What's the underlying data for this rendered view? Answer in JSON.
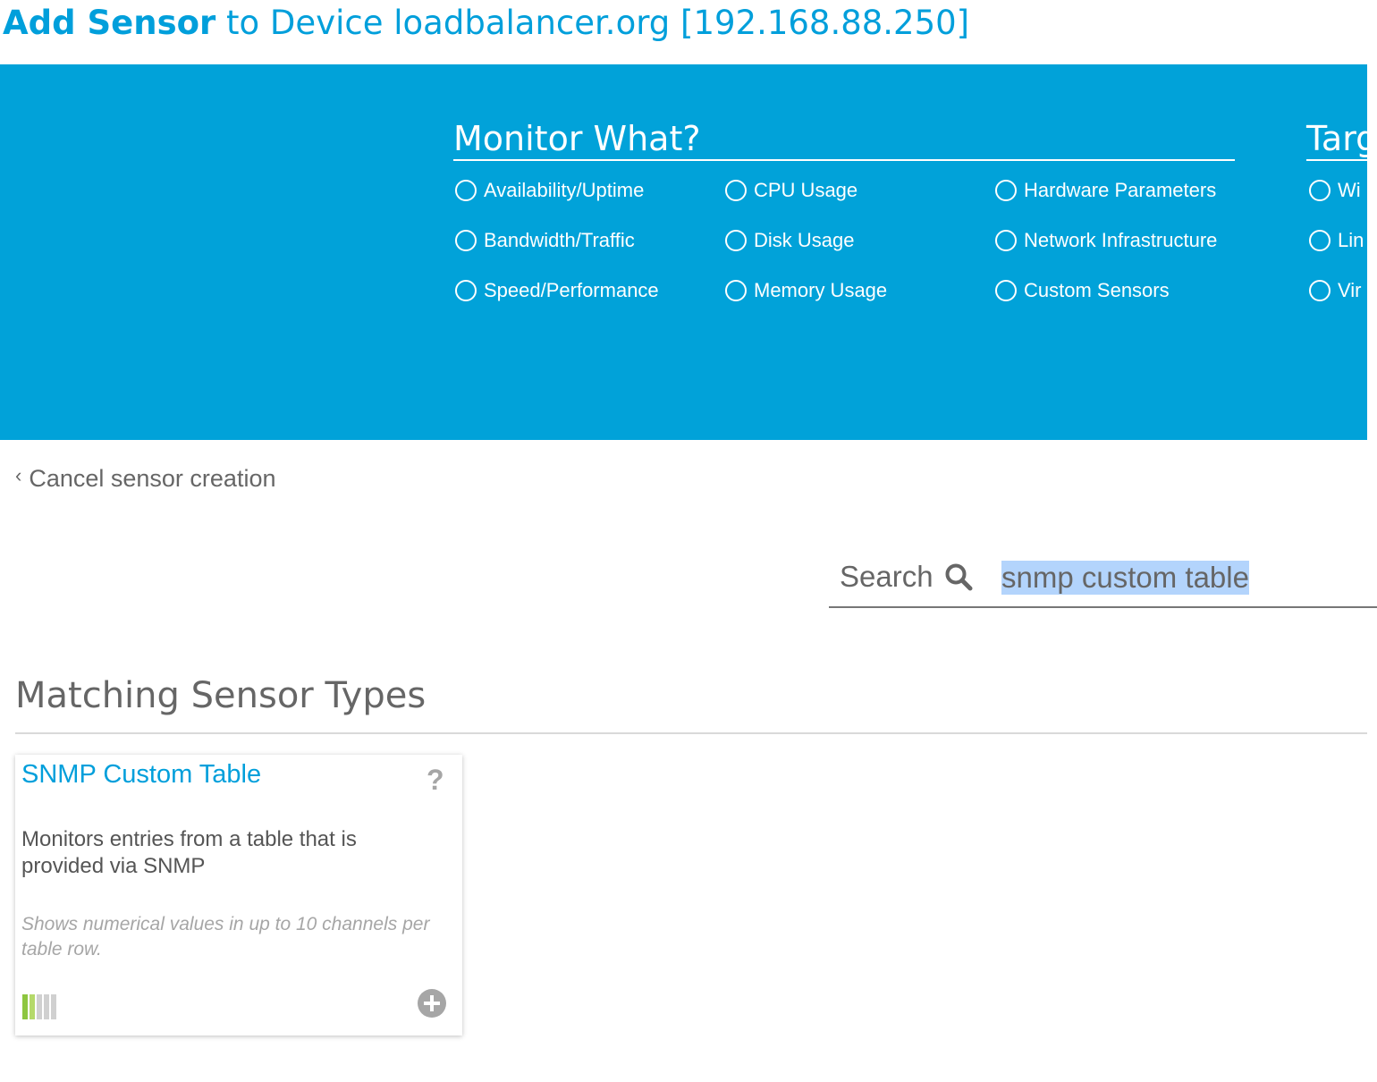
{
  "header": {
    "title_bold": "Add Sensor",
    "title_rest": "to Device",
    "device": "loadbalancer.org [192.168.88.250]"
  },
  "filters": {
    "monitor_what": {
      "title": "Monitor What?",
      "options": [
        "Availability/Uptime",
        "Bandwidth/Traffic",
        "Speed/Performance",
        "CPU Usage",
        "Disk Usage",
        "Memory Usage",
        "Hardware Parameters",
        "Network Infrastructure",
        "Custom Sensors"
      ]
    },
    "target_system": {
      "title": "Targ",
      "options": [
        "Wi",
        "Lin",
        "Vir"
      ]
    }
  },
  "cancel": {
    "label": "Cancel sensor creation"
  },
  "search": {
    "label": "Search",
    "value": "snmp custom table"
  },
  "results": {
    "title": "Matching Sensor Types",
    "cards": [
      {
        "title": "SNMP Custom Table",
        "description": "Monitors entries from a table that is provided via SNMP",
        "note": "Shows numerical values in up to 10 channels per table row.",
        "bars_active": 2,
        "bars_total": 5,
        "colors": {
          "active_1": "#8dc63f",
          "active_2": "#b5d96a",
          "inactive": "#d0d0d0"
        }
      }
    ]
  },
  "colors": {
    "accent": "#009fdb",
    "banner": "#01a2d9"
  }
}
